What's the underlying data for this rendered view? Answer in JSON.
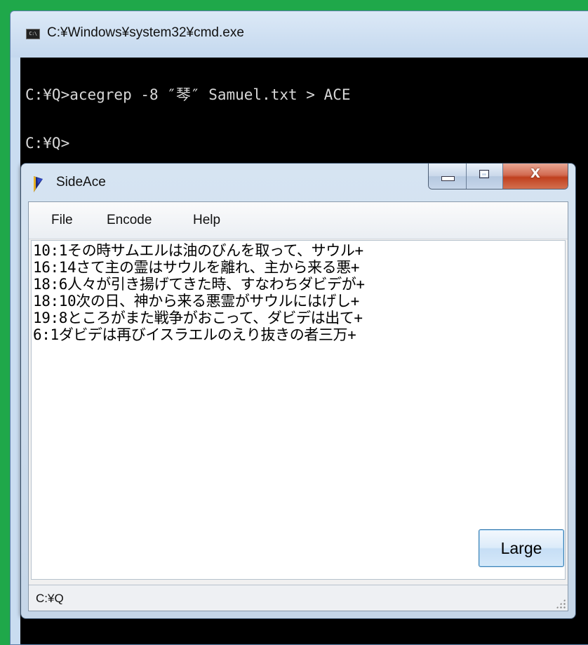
{
  "cmd": {
    "title": "C:¥Windows¥system32¥cmd.exe",
    "icon": "console-icon",
    "icon_text": "C:\\",
    "lines": [
      "C:¥Q>acegrep -8 ″琴″ Samuel.txt > ACE",
      "C:¥Q>"
    ]
  },
  "sideace": {
    "title": "SideAce",
    "icon": "harp-icon",
    "controls": {
      "minimize": "minimize-icon",
      "maximize": "maximize-icon",
      "close": "X"
    },
    "menu": [
      "File",
      "Encode",
      "Help"
    ],
    "results": [
      "10:1その時サムエルは油のびんを取って、サウル+",
      "16:14さて主の霊はサウルを離れ、主から来る悪+",
      "18:6人々が引き揚げてきた時、すなわちダビデが+",
      "18:10次の日、神から来る悪霊がサウルにはげし+",
      "19:8ところがまた戦争がおこって、ダビデは出て+",
      "6:1ダビデは再びイスラエルのえり抜きの者三万+"
    ],
    "large_button": "Large",
    "status": "C:¥Q"
  },
  "colors": {
    "desktop": "#1fa84a",
    "console_bg": "#000000",
    "console_text": "#d8d8d8",
    "close_button": "#c0401f",
    "button_border": "#3c7fb1"
  }
}
